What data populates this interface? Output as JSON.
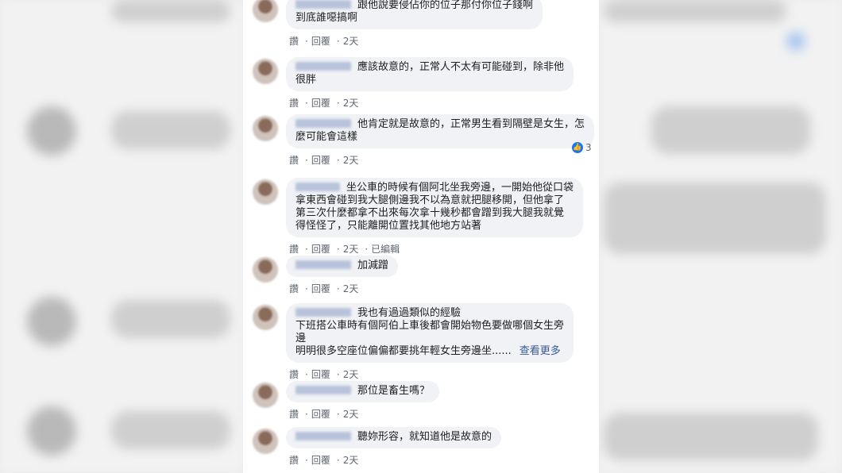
{
  "comments": [
    {
      "lines": [
        "跟他說要侵佔你的位子那付你位子錢啊",
        "到底誰噁搞啊"
      ],
      "time": "2天",
      "edited": ""
    },
    {
      "lines": [
        "應該故意的，正常人不太有可能碰到，除非他",
        "很胖"
      ],
      "time": "2天",
      "edited": ""
    },
    {
      "lines": [
        "他肯定就是故意的，正常男生看到隔壁是女生，怎",
        "麼可能會這樣"
      ],
      "time": "2天",
      "edited": "",
      "reaction_count": "3"
    },
    {
      "lines": [
        "坐公車的時候有個阿北坐我旁邊，一開始他從口袋",
        "拿東西會碰到我大腿側邊我不以為意就把腿移開，但他拿了",
        "第三次什麼都拿不出來每次拿十幾秒都會蹭到我大腿我就覺",
        "得怪怪了，只能離開位置找其他地方站著"
      ],
      "time": "2天",
      "edited": "已編輯"
    },
    {
      "lines": [
        "加減蹭"
      ],
      "time": "2天",
      "edited": ""
    },
    {
      "lines": [
        "我也有過過類似的經驗",
        "下班搭公車時有個阿伯上車後都會開始物色要做哪個女生旁",
        "邊",
        "明明很多空座位偏偏都要挑年輕女生旁邊坐......"
      ],
      "see_more": "查看更多",
      "time": "2天",
      "edited": ""
    },
    {
      "lines": [
        "那位是畜生嗎？"
      ],
      "time": "2天",
      "edited": ""
    },
    {
      "lines": [
        "聽妳形容，就知道他是故意的"
      ],
      "time": "2天",
      "edited": ""
    }
  ],
  "actions": {
    "like": "讚",
    "reply": "回覆"
  },
  "colors": {
    "bubble": "#f0f2f5",
    "link": "#385898",
    "like_blue": "#1877f2"
  },
  "icons": {
    "reaction": "like-icon"
  }
}
